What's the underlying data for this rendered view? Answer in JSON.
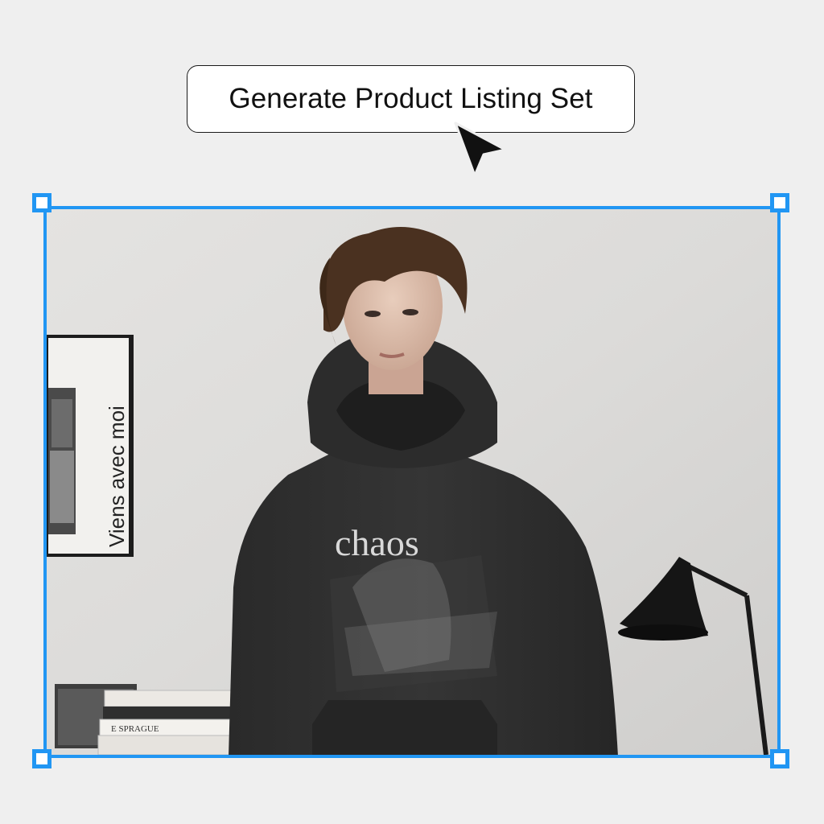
{
  "action_button": {
    "label": "Generate Product Listing Set"
  },
  "cursor": {
    "icon": "arrow-pointer-icon"
  },
  "selection": {
    "border_color": "#2196f3",
    "handles": [
      "top-left",
      "top-right",
      "bottom-left",
      "bottom-right"
    ]
  },
  "photo": {
    "poster_text": "Viens avec moi",
    "hoodie_print_text": "chaos",
    "book_spine_text": "E SPRAGUE"
  }
}
